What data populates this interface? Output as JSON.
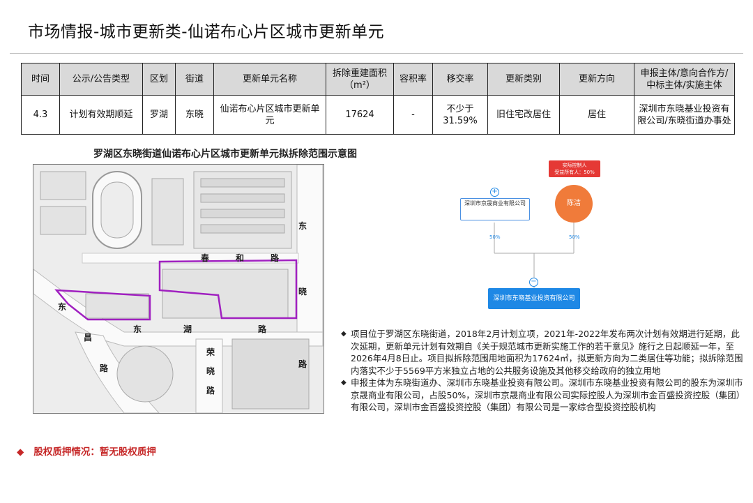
{
  "page_title": "市场情报-城市更新类-仙诺布心片区城市更新单元",
  "table": {
    "headers": [
      "时间",
      "公示/公告类型",
      "区划",
      "街道",
      "更新单元名称",
      "拆除重建面积（m²）",
      "容积率",
      "移交率",
      "更新类别",
      "更新方向",
      "申报主体/意向合作方/中标主体/实施主体"
    ],
    "row": [
      "4.3",
      "计划有效期顺延",
      "罗湖",
      "东晓",
      "仙诺布心片区城市更新单元",
      "17624",
      "-",
      "不少于31.59%",
      "旧住宅改居住",
      "居住",
      "深圳市东晓基业投资有限公司/东晓街道办事处"
    ]
  },
  "map": {
    "title": "罗湖区东晓街道仙诺布心片区城市更新单元拟拆除范围示意图",
    "road_labels": {
      "chunhe": [
        "春",
        "和",
        "路"
      ],
      "dongxiao": [
        "东",
        "晓",
        "路"
      ],
      "donghu": [
        "东",
        "湖",
        "路"
      ],
      "rongxiao": [
        "荣",
        "晓",
        "路"
      ],
      "dongchang": [
        "东",
        "昌",
        "路"
      ]
    },
    "boundary_color": "#a020c0"
  },
  "graph": {
    "company_left": "深圳市京晟商业有限公司",
    "person": "陈洁",
    "person_tag_line1": "实际控制人",
    "person_tag_line2": "受益所有人：50%",
    "pct_left": "50%",
    "pct_right": "50%",
    "target": "深圳市东晓基业投资有限公司",
    "plus_symbol": "+",
    "minus_symbol": "−"
  },
  "bullets": [
    "项目位于罗湖区东晓街道，2018年2月计划立项，2021年-2022年发布两次计划有效期进行延期，此次延期，更新单元计划有效期自《关于规范城市更新实施工作的若干意见》施行之日起顺延一年，至2026年4月8日止。项目拟拆除范围用地面积为17624㎡，拟更新方向为二类居住等功能；拟拆除范围内落实不少于5569平方米独立占地的公共服务设施及其他移交给政府的独立用地",
    "申报主体为东晓街道办、深圳市东晓基业投资有限公司。深圳市东晓基业投资有限公司的股东为深圳市京晟商业有限公司，占股50%，深圳市京晟商业有限公司实际控股人为深圳市金百盛投资控股（集团）有限公司，深圳市金百盛投资控股（集团）有限公司是一家综合型投资控股机构"
  ],
  "bullet_symbol": "◆",
  "pledge": {
    "symbol": "◆",
    "text": "股权质押情况：暂无股权质押"
  }
}
